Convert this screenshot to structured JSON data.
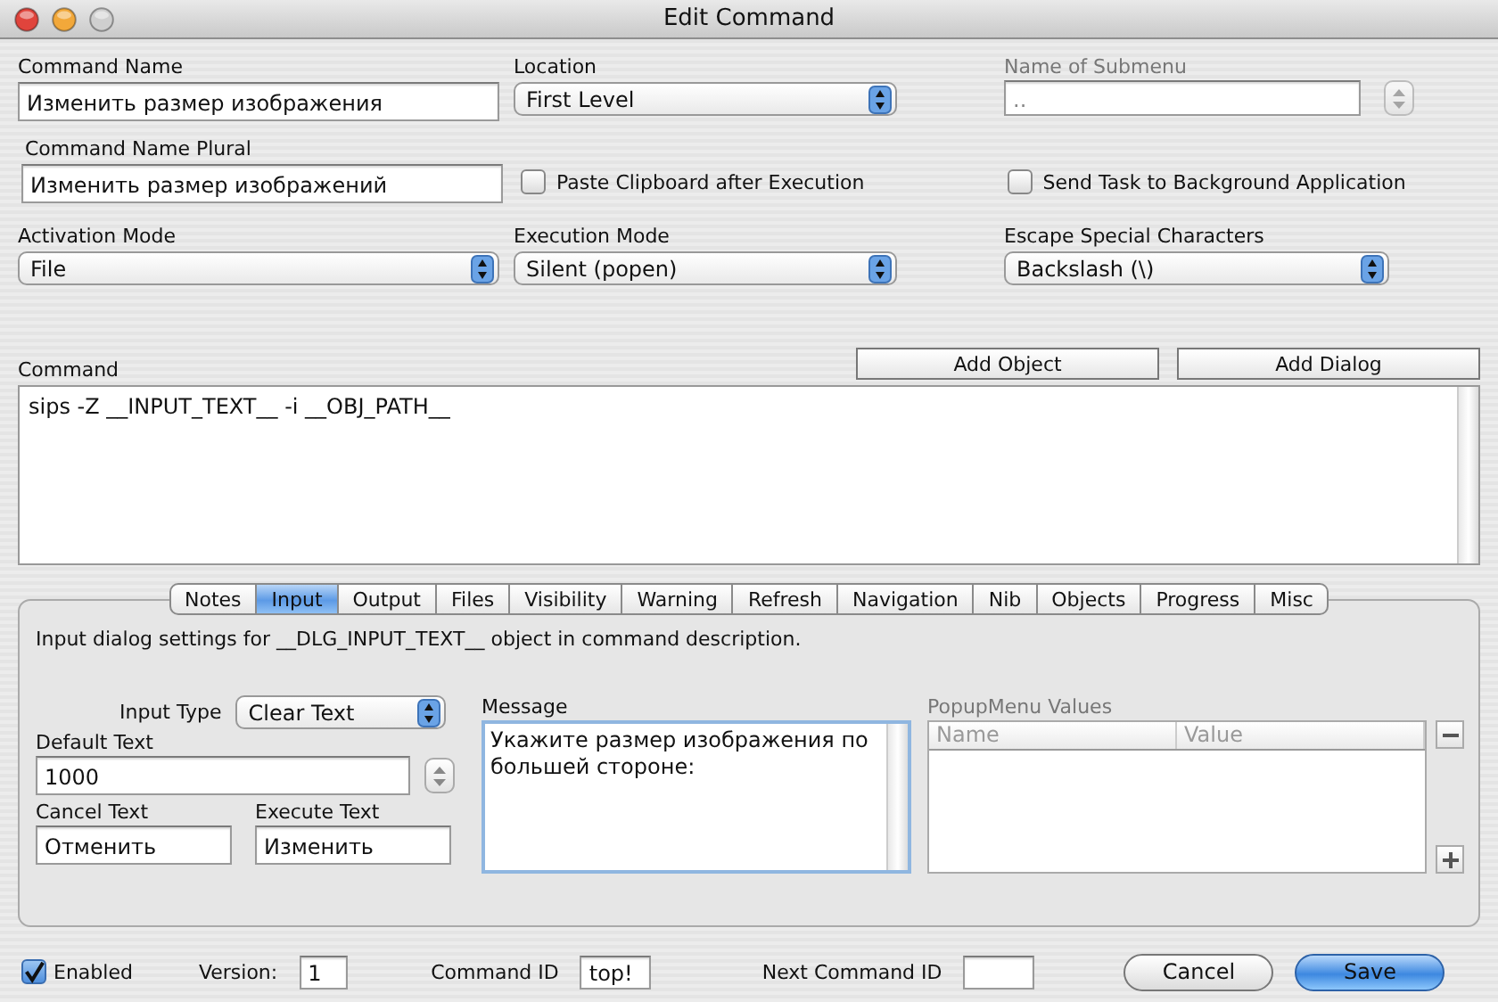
{
  "window": {
    "title": "Edit Command"
  },
  "top_fields": [
    {
      "kind": "text",
      "label": "Command Name",
      "value": "Изменить размер изображения"
    },
    {
      "kind": "popup",
      "label": "Location",
      "value": "First Level"
    },
    {
      "kind": "combo",
      "label": "Name of Submenu",
      "value": "..",
      "disabled": true
    },
    {
      "kind": "text",
      "label": "Command Name Plural",
      "value": "Изменить размер изображений"
    },
    {
      "kind": "checkbox",
      "label": "Paste Clipboard after Execution",
      "checked": false
    },
    {
      "kind": "checkbox",
      "label": "Send Task to Background Application",
      "checked": false
    },
    {
      "kind": "popup",
      "label": "Activation Mode",
      "value": "File"
    },
    {
      "kind": "popup",
      "label": "Execution Mode",
      "value": "Silent (popen)"
    },
    {
      "kind": "popup",
      "label": "Escape Special Characters",
      "value": "Backslash (\\)"
    }
  ],
  "command": {
    "label": "Command",
    "value": "sips -Z __INPUT_TEXT__ -i __OBJ_PATH__",
    "buttons": [
      "Add Object",
      "Add Dialog"
    ]
  },
  "tabs": [
    {
      "label": "Notes",
      "selected": false
    },
    {
      "label": "Input",
      "selected": true
    },
    {
      "label": "Output",
      "selected": false
    },
    {
      "label": "Files",
      "selected": false
    },
    {
      "label": "Visibility",
      "selected": false
    },
    {
      "label": "Warning",
      "selected": false
    },
    {
      "label": "Refresh",
      "selected": false
    },
    {
      "label": "Navigation",
      "selected": false
    },
    {
      "label": "Nib",
      "selected": false
    },
    {
      "label": "Objects",
      "selected": false
    },
    {
      "label": "Progress",
      "selected": false
    },
    {
      "label": "Misc",
      "selected": false
    }
  ],
  "panel": {
    "description": "Input dialog settings for __DLG_INPUT_TEXT__ object in command description.",
    "input_type": {
      "label": "Input Type",
      "value": "Clear Text"
    },
    "default_text": {
      "label": "Default Text",
      "value": "1000"
    },
    "cancel_text": {
      "label": "Cancel Text",
      "value": "Отменить"
    },
    "execute_text": {
      "label": "Execute Text",
      "value": "Изменить"
    },
    "message": {
      "label": "Message",
      "value": "Укажите размер изображения по большей стороне:"
    },
    "popup_values": {
      "label": "PopupMenu Values",
      "disabled": true,
      "columns": [
        "Name",
        "Value"
      ]
    }
  },
  "footer": {
    "enabled": {
      "label": "Enabled",
      "checked": true
    },
    "fields": [
      {
        "label": "Version:",
        "value": "1"
      },
      {
        "label": "Command ID",
        "value": "top!"
      },
      {
        "label": "Next Command ID"
      }
    ],
    "buttons": [
      {
        "label": "Cancel",
        "default": false
      },
      {
        "label": "Save",
        "default": true
      }
    ]
  }
}
